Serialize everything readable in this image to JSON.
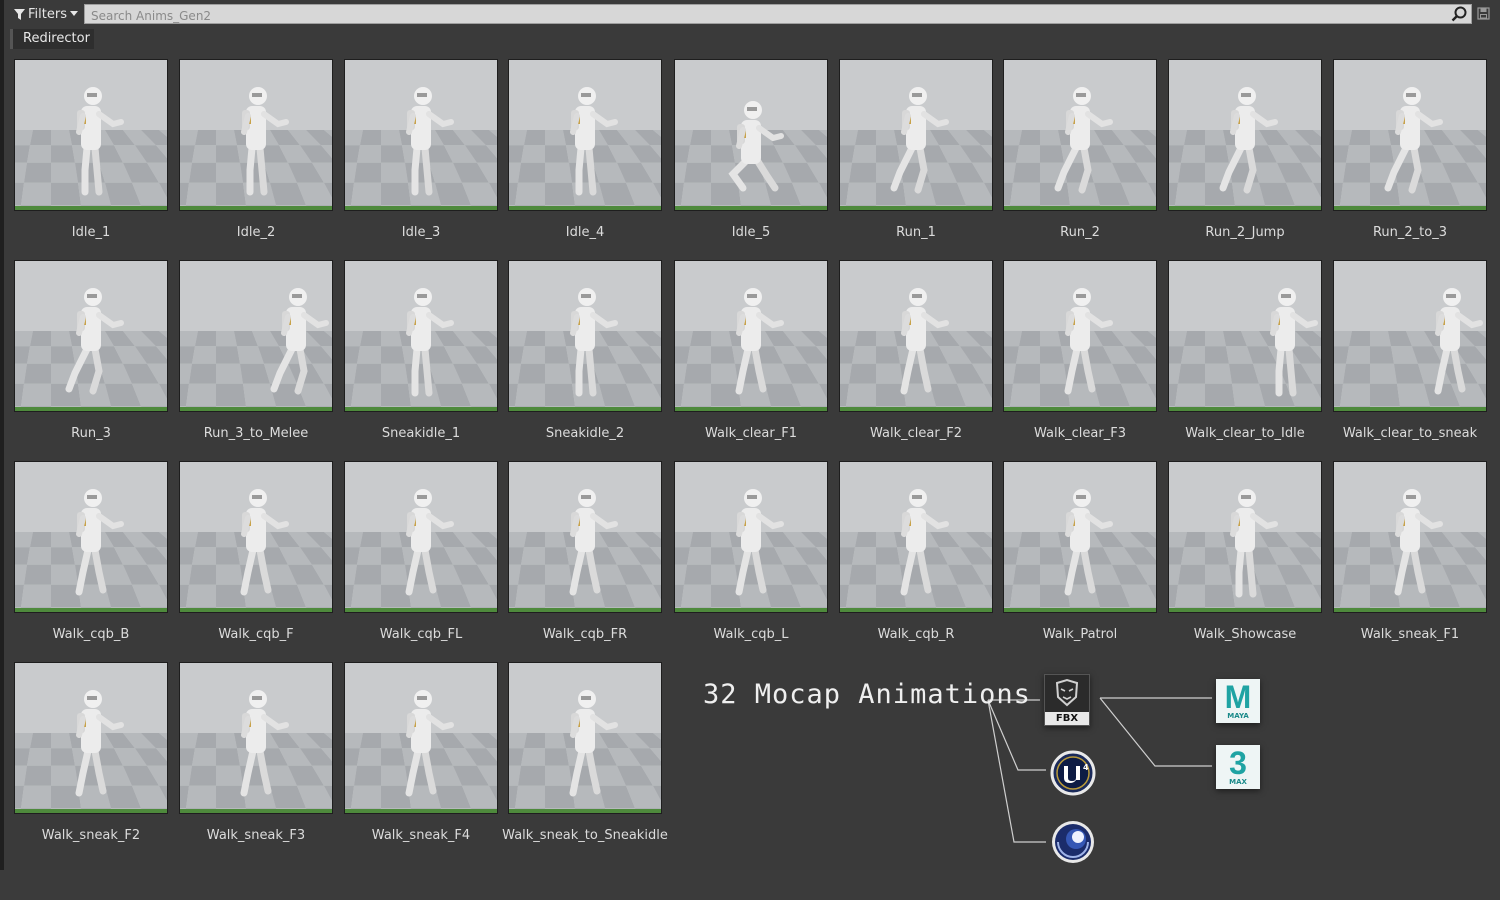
{
  "toolbar": {
    "filters_label": "Filters",
    "search_placeholder": "Search Anims_Gen2"
  },
  "active_filter": "Redirector",
  "assets": [
    {
      "name": "Idle_1"
    },
    {
      "name": "Idle_2"
    },
    {
      "name": "Idle_3"
    },
    {
      "name": "Idle_4"
    },
    {
      "name": "Idle_5"
    },
    {
      "name": "Run_1"
    },
    {
      "name": "Run_2"
    },
    {
      "name": "Run_2_Jump"
    },
    {
      "name": "Run_2_to_3"
    },
    {
      "name": "Run_3"
    },
    {
      "name": "Run_3_to_Melee"
    },
    {
      "name": "Sneakidle_1"
    },
    {
      "name": "Sneakidle_2"
    },
    {
      "name": "Walk_clear_F1"
    },
    {
      "name": "Walk_clear_F2"
    },
    {
      "name": "Walk_clear_F3"
    },
    {
      "name": "Walk_clear_to_Idle"
    },
    {
      "name": "Walk_clear_to_sneak"
    },
    {
      "name": "Walk_cqb_B"
    },
    {
      "name": "Walk_cqb_F"
    },
    {
      "name": "Walk_cqb_FL"
    },
    {
      "name": "Walk_cqb_FR"
    },
    {
      "name": "Walk_cqb_L"
    },
    {
      "name": "Walk_cqb_R"
    },
    {
      "name": "Walk_Patrol"
    },
    {
      "name": "Walk_Showcase"
    },
    {
      "name": "Walk_sneak_F1"
    },
    {
      "name": "Walk_sneak_F2"
    },
    {
      "name": "Walk_sneak_F3"
    },
    {
      "name": "Walk_sneak_F4"
    },
    {
      "name": "Walk_sneak_to_Sneakidle"
    }
  ],
  "promo": {
    "title": "32 Mocap Animations",
    "fbx_label": "FBX",
    "maya_letter": "M",
    "maya_label": "MAYA",
    "max_letter": "3",
    "max_label": "MAX"
  },
  "colors": {
    "background": "#3a3a3a",
    "thumbnail_status_bar": "#4e8a3c",
    "maya_teal": "#1fa3a3"
  }
}
